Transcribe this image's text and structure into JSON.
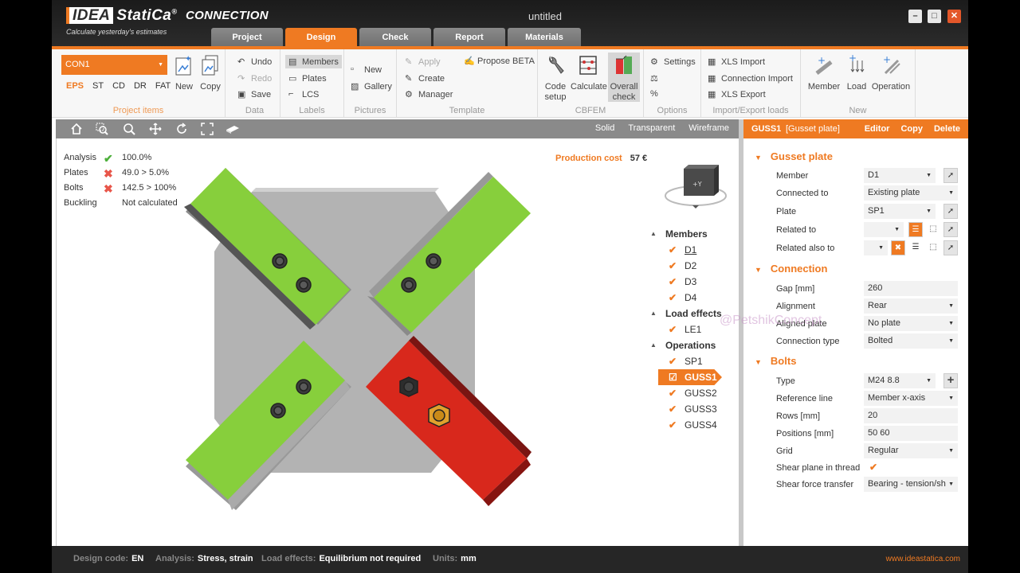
{
  "app": {
    "logo_brand": "IDEA",
    "logo_name": "StatiCa",
    "logo_reg": "®",
    "product": "CONNECTION",
    "tagline": "Calculate yesterday's estimates",
    "doc_title": "untitled"
  },
  "tabs": [
    "Project",
    "Design",
    "Check",
    "Report",
    "Materials"
  ],
  "ribbon": {
    "project_items": {
      "connection": "CON1",
      "codes": [
        "EPS",
        "ST",
        "CD",
        "DR",
        "FAT"
      ],
      "new": "New",
      "copy": "Copy",
      "label": "Project items"
    },
    "data": {
      "undo": "Undo",
      "redo": "Redo",
      "save": "Save",
      "label": "Data"
    },
    "labels": {
      "members": "Members",
      "plates": "Plates",
      "lcs": "LCS",
      "label": "Labels"
    },
    "pictures": {
      "new": "New",
      "gallery": "Gallery",
      "label": "Pictures"
    },
    "template": {
      "apply": "Apply",
      "propose": "Propose BETA",
      "create": "Create",
      "manager": "Manager",
      "label": "Template"
    },
    "cbfem": {
      "code_setup": "Code setup",
      "calculate": "Calculate",
      "overall_check": "Overall check",
      "label": "CBFEM"
    },
    "options": {
      "settings": "Settings",
      "label": "Options"
    },
    "import_export": {
      "xls_import": "XLS Import",
      "connection_import": "Connection Import",
      "xls_export": "XLS Export",
      "label": "Import/Export loads"
    },
    "new_group": {
      "member": "Member",
      "load": "Load",
      "operation": "Operation",
      "label": "New"
    }
  },
  "viewport": {
    "modes": [
      "Solid",
      "Transparent",
      "Wireframe"
    ],
    "results": [
      {
        "label": "Analysis",
        "ok": true,
        "value": "100.0%"
      },
      {
        "label": "Plates",
        "ok": false,
        "value": "49.0 > 5.0%"
      },
      {
        "label": "Bolts",
        "ok": false,
        "value": "142.5 > 100%"
      },
      {
        "label": "Buckling",
        "ok": null,
        "value": "Not calculated"
      }
    ],
    "production_cost_label": "Production cost",
    "production_cost_value": "57 €",
    "navcube_label": "+Y"
  },
  "tree": {
    "members_label": "Members",
    "members": [
      "D1",
      "D2",
      "D3",
      "D4"
    ],
    "load_effects_label": "Load effects",
    "load_effects": [
      "LE1"
    ],
    "operations_label": "Operations",
    "operations": [
      "SP1",
      "GUSS1",
      "GUSS2",
      "GUSS3",
      "GUSS4"
    ]
  },
  "properties": {
    "object": "GUSS1",
    "kind": "[Gusset plate]",
    "actions": [
      "Editor",
      "Copy",
      "Delete"
    ],
    "gusset_title": "Gusset plate",
    "gusset": {
      "member_label": "Member",
      "member": "D1",
      "connected_to_label": "Connected to",
      "connected_to": "Existing plate",
      "plate_label": "Plate",
      "plate": "SP1",
      "related_to_label": "Related to",
      "related_to": "",
      "related_also_label": "Related also to",
      "related_also": ""
    },
    "connection_title": "Connection",
    "connection": {
      "gap_label": "Gap [mm]",
      "gap": "260",
      "alignment_label": "Alignment",
      "alignment": "Rear",
      "aligned_plate_label": "Aligned plate",
      "aligned_plate": "No plate",
      "type_label": "Connection type",
      "type": "Bolted"
    },
    "bolts_title": "Bolts",
    "bolts": {
      "type_label": "Type",
      "type": "M24 8.8",
      "ref_line_label": "Reference line",
      "ref_line": "Member x-axis",
      "rows_label": "Rows [mm]",
      "rows": "20",
      "positions_label": "Positions [mm]",
      "positions": "50 60",
      "grid_label": "Grid",
      "grid": "Regular",
      "shear_plane_label": "Shear plane in thread",
      "shear_plane": true,
      "shear_transfer_label": "Shear force transfer",
      "shear_transfer": "Bearing - tension/sh"
    }
  },
  "watermark": "@PetshikConcept",
  "status": {
    "design_code_label": "Design code:",
    "design_code": "EN",
    "analysis_label": "Analysis:",
    "analysis": "Stress, strain",
    "load_effects_label": "Load effects:",
    "load_effects": "Equilibrium not required",
    "units_label": "Units:",
    "units": "mm",
    "website": "www.ideastatica.com"
  },
  "colors": {
    "accent": "#ef7a22",
    "member_ok": "#8dd43a",
    "member_fail": "#d8281c",
    "plate": "#b0b0b0"
  }
}
